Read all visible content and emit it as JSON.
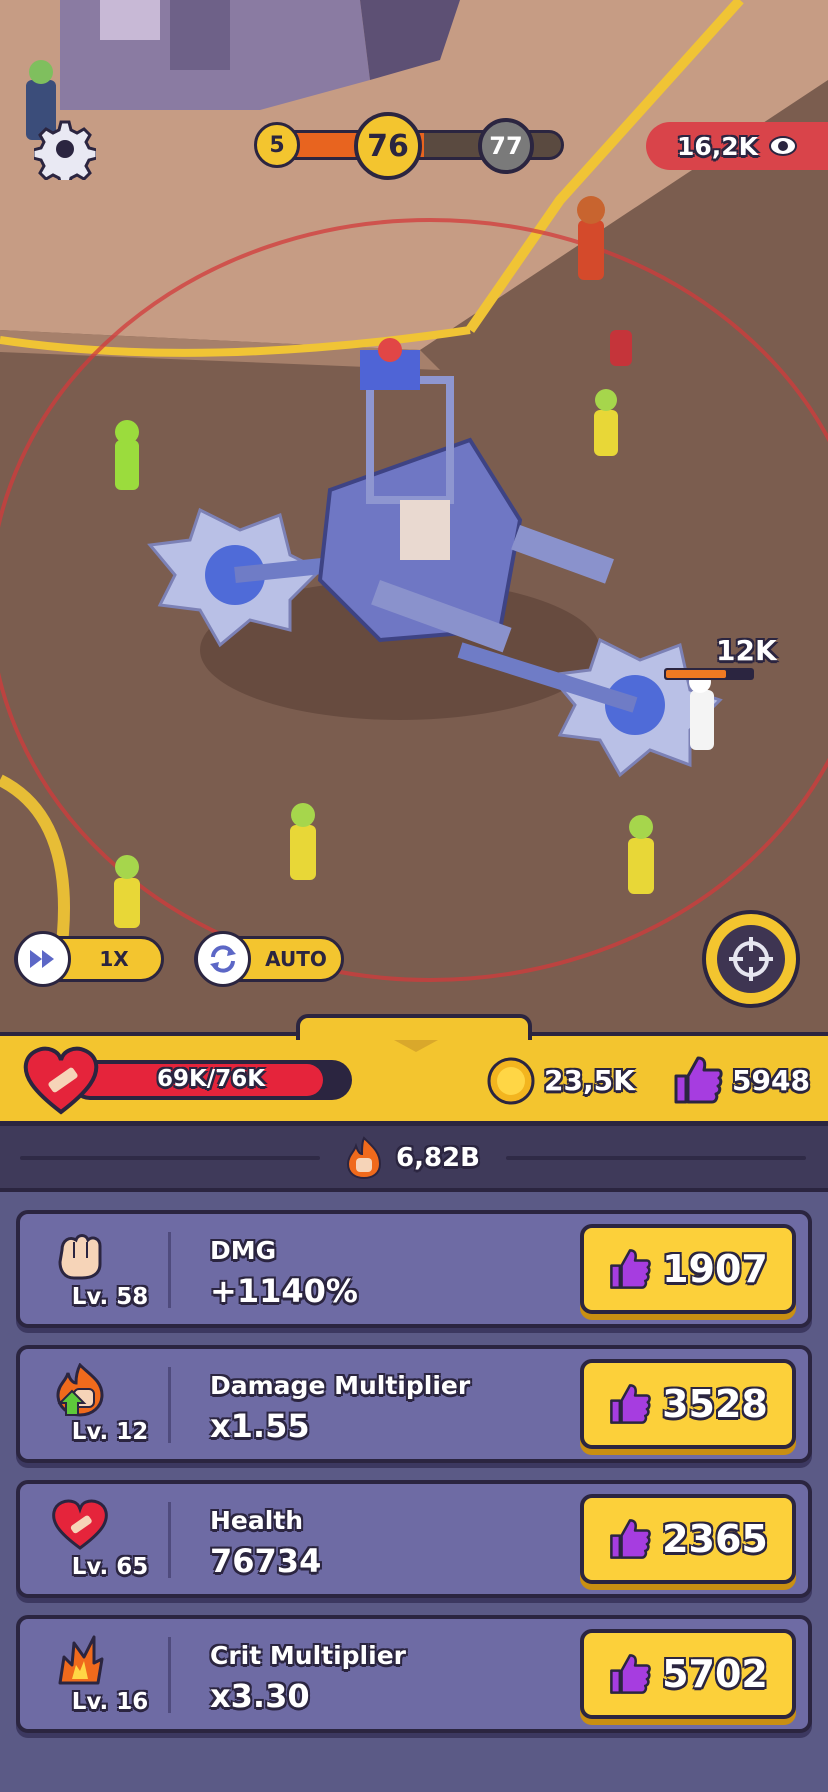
{
  "level_bar": {
    "prev": "5",
    "current": "76",
    "next": "77"
  },
  "viewers": "16,2K",
  "enemy_damage_label": "12K",
  "controls": {
    "speed_label": "1X",
    "auto_label": "AUTO"
  },
  "stats": {
    "health_text": "69K/76K",
    "health_fraction": 0.908,
    "coins": "23,5K",
    "likes": "5948",
    "power": "6,82B"
  },
  "upgrades": [
    {
      "name": "DMG",
      "value": "+1140%",
      "level": "Lv. 58",
      "price": "1907",
      "icon": "fist-icon"
    },
    {
      "name": "Damage Multiplier",
      "value": "x1.55",
      "level": "Lv. 12",
      "price": "3528",
      "icon": "fire-fist-icon"
    },
    {
      "name": "Health",
      "value": "76734",
      "level": "Lv. 65",
      "price": "2365",
      "icon": "heart-icon"
    },
    {
      "name": "Crit Multiplier",
      "value": "x3.30",
      "level": "Lv. 16",
      "price": "5702",
      "icon": "crit-icon"
    }
  ],
  "colors": {
    "panel": "#6e6ba4",
    "button": "#fcd03a",
    "hud_yellow": "#f3c52f",
    "health_red": "#e5243b",
    "like_purple": "#a63de0"
  }
}
